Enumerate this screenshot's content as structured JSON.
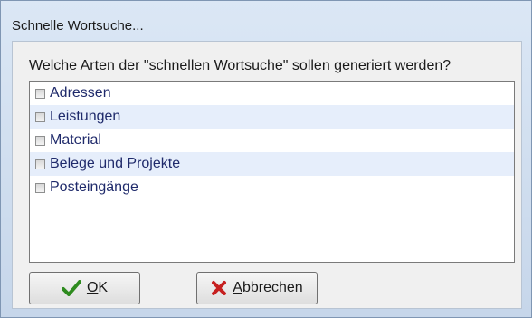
{
  "window": {
    "title": "Schnelle Wortsuche..."
  },
  "dialog": {
    "question": "Welche Arten der \"schnellen Wortsuche\" sollen generiert werden?",
    "items": [
      {
        "label": "Adressen",
        "checked": false
      },
      {
        "label": "Leistungen",
        "checked": false
      },
      {
        "label": "Material",
        "checked": false
      },
      {
        "label": "Belege und Projekte",
        "checked": false
      },
      {
        "label": "Posteingänge",
        "checked": false
      }
    ]
  },
  "buttons": {
    "ok": {
      "label_mnemonic": "O",
      "label_rest": "K",
      "icon": "checkmark-icon",
      "icon_color": "#2e8b1f"
    },
    "cancel": {
      "label_mnemonic": "A",
      "label_rest": "bbrechen",
      "icon": "cross-icon",
      "icon_color": "#c62020"
    }
  }
}
